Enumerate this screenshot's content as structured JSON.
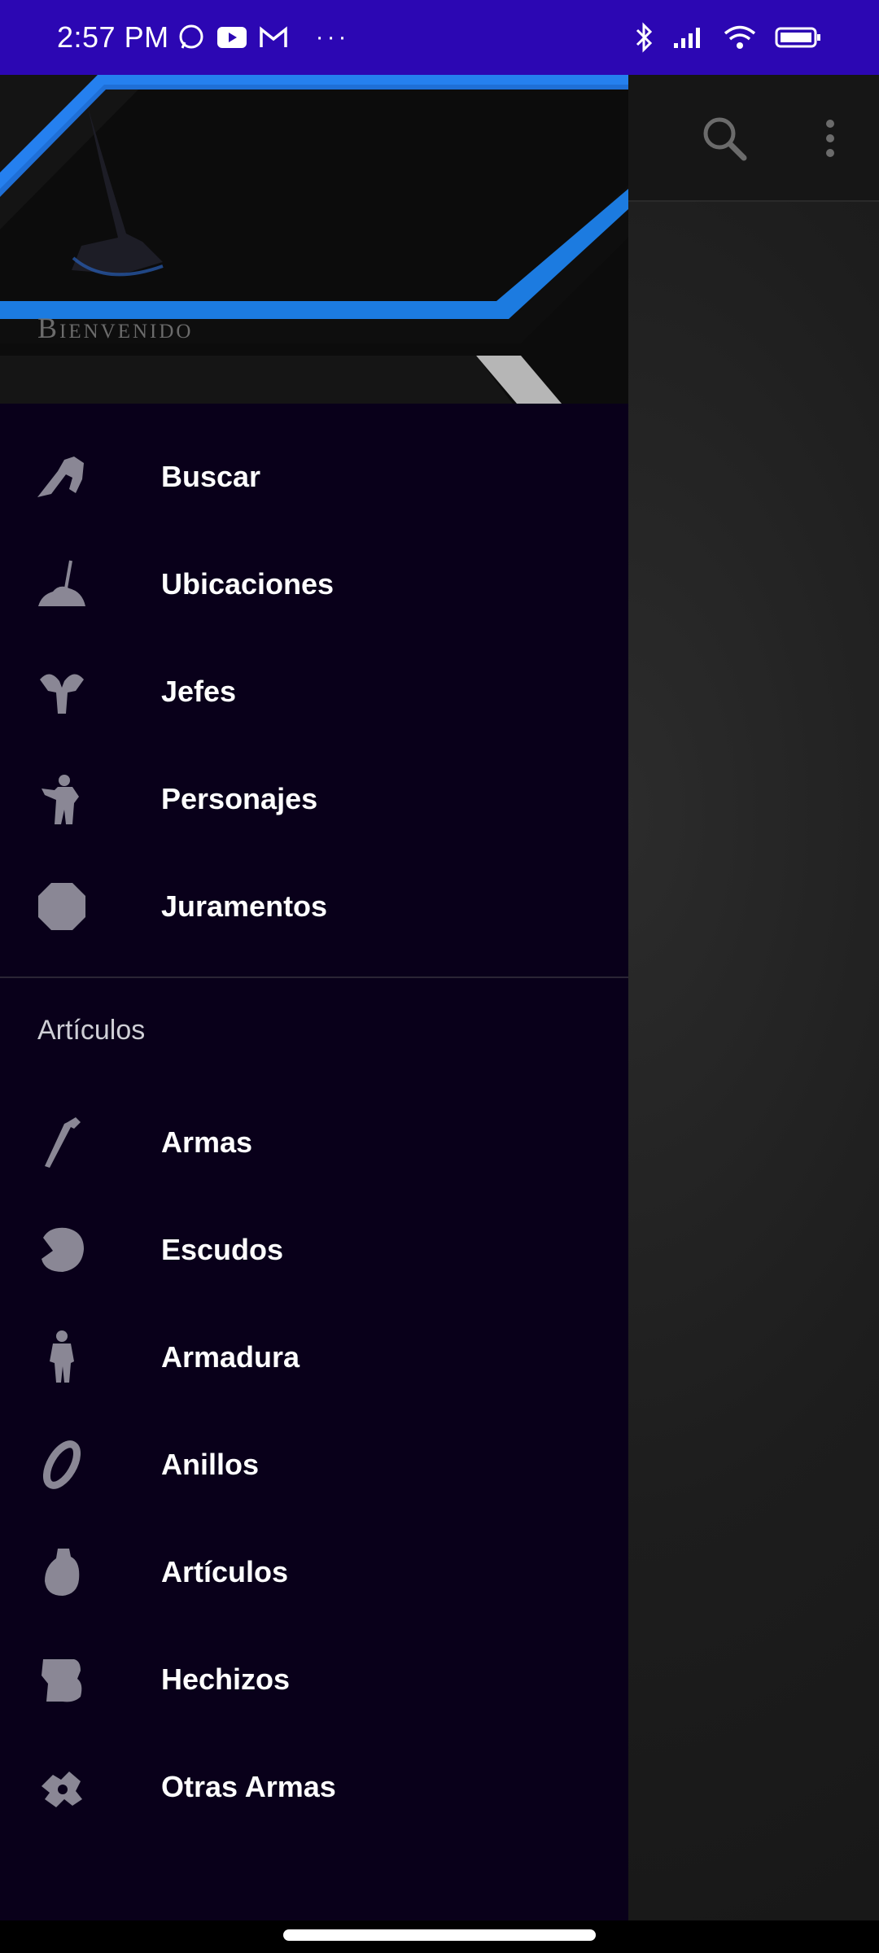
{
  "status_bar": {
    "time": "2:57 PM"
  },
  "drawer": {
    "header_title": "Bienvenido",
    "items": [
      {
        "label": "Buscar",
        "icon": "knight-icon"
      },
      {
        "label": "Ubicaciones",
        "icon": "bonfire-icon"
      },
      {
        "label": "Jefes",
        "icon": "gargoyle-icon"
      },
      {
        "label": "Personajes",
        "icon": "character-icon"
      },
      {
        "label": "Juramentos",
        "icon": "oath-icon"
      }
    ],
    "section_title": "Artículos",
    "section_items": [
      {
        "label": "Armas",
        "icon": "sword-icon"
      },
      {
        "label": "Escudos",
        "icon": "shield-icon"
      },
      {
        "label": "Armadura",
        "icon": "armor-icon"
      },
      {
        "label": "Anillos",
        "icon": "ring-icon"
      },
      {
        "label": "Artículos",
        "icon": "item-icon"
      },
      {
        "label": "Hechizos",
        "icon": "spell-icon"
      },
      {
        "label": "Otras Armas",
        "icon": "other-weapons-icon"
      }
    ]
  },
  "colors": {
    "status_bar": "#2c07b3",
    "drawer_bg": "#09001a",
    "accent": "#1e88e5",
    "icon": "#8a8795"
  }
}
